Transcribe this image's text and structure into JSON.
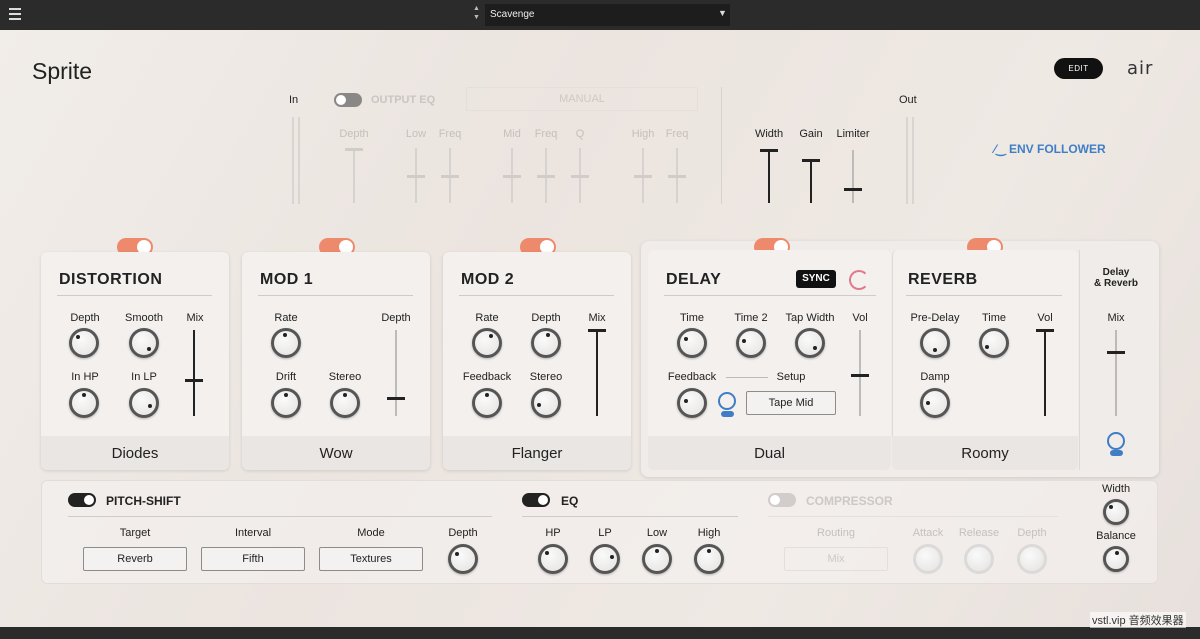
{
  "topbar": {
    "preset_name": "Scavenge",
    "arrows": "▲\n▼",
    "caret": "▼"
  },
  "header": {
    "app_title": "Sprite",
    "edit_label": "EDIT",
    "brand": "air"
  },
  "io": {
    "in_label": "In",
    "out_label": "Out"
  },
  "output_eq": {
    "label": "OUTPUT EQ",
    "mode": "MANUAL",
    "sliders": [
      {
        "label": "Depth"
      },
      {
        "label": "Low"
      },
      {
        "label": "Freq"
      },
      {
        "label": "Mid"
      },
      {
        "label": "Freq"
      },
      {
        "label": "Q"
      },
      {
        "label": "High"
      },
      {
        "label": "Freq"
      }
    ]
  },
  "stereo": {
    "width": "Width",
    "gain": "Gain",
    "limiter": "Limiter"
  },
  "env_follower": {
    "label": "ENV FOLLOWER"
  },
  "distortion": {
    "title": "DISTORTION",
    "depth": "Depth",
    "smooth": "Smooth",
    "mix": "Mix",
    "in_hp": "In HP",
    "in_lp": "In LP",
    "mode": "Diodes"
  },
  "mod1": {
    "title": "MOD 1",
    "rate": "Rate",
    "depth": "Depth",
    "drift": "Drift",
    "stereo": "Stereo",
    "mode": "Wow"
  },
  "mod2": {
    "title": "MOD 2",
    "rate": "Rate",
    "depth": "Depth",
    "mix": "Mix",
    "feedback": "Feedback",
    "stereo": "Stereo",
    "mode": "Flanger"
  },
  "delay": {
    "title": "DELAY",
    "sync": "SYNC",
    "time": "Time",
    "time2": "Time 2",
    "tap_width": "Tap Width",
    "vol": "Vol",
    "feedback": "Feedback",
    "setup": "Setup",
    "setup_value": "Tape Mid",
    "mode": "Dual"
  },
  "reverb": {
    "title": "REVERB",
    "predelay": "Pre-Delay",
    "time": "Time",
    "vol": "Vol",
    "damp": "Damp",
    "mode": "Roomy"
  },
  "delay_reverb": {
    "title_line1": "Delay",
    "title_line2": "& Reverb",
    "mix": "Mix"
  },
  "pitch_shift": {
    "title": "PITCH-SHIFT",
    "target_label": "Target",
    "target_value": "Reverb",
    "interval_label": "Interval",
    "interval_value": "Fifth",
    "mode_label": "Mode",
    "mode_value": "Textures",
    "depth": "Depth"
  },
  "eq": {
    "title": "EQ",
    "hp": "HP",
    "lp": "LP",
    "low": "Low",
    "high": "High"
  },
  "compressor": {
    "title": "COMPRESSOR",
    "routing_label": "Routing",
    "routing_value": "Mix",
    "attack": "Attack",
    "release": "Release",
    "depth": "Depth"
  },
  "master": {
    "width": "Width",
    "balance": "Balance"
  },
  "watermark": "vstl.vip 音频效果器"
}
